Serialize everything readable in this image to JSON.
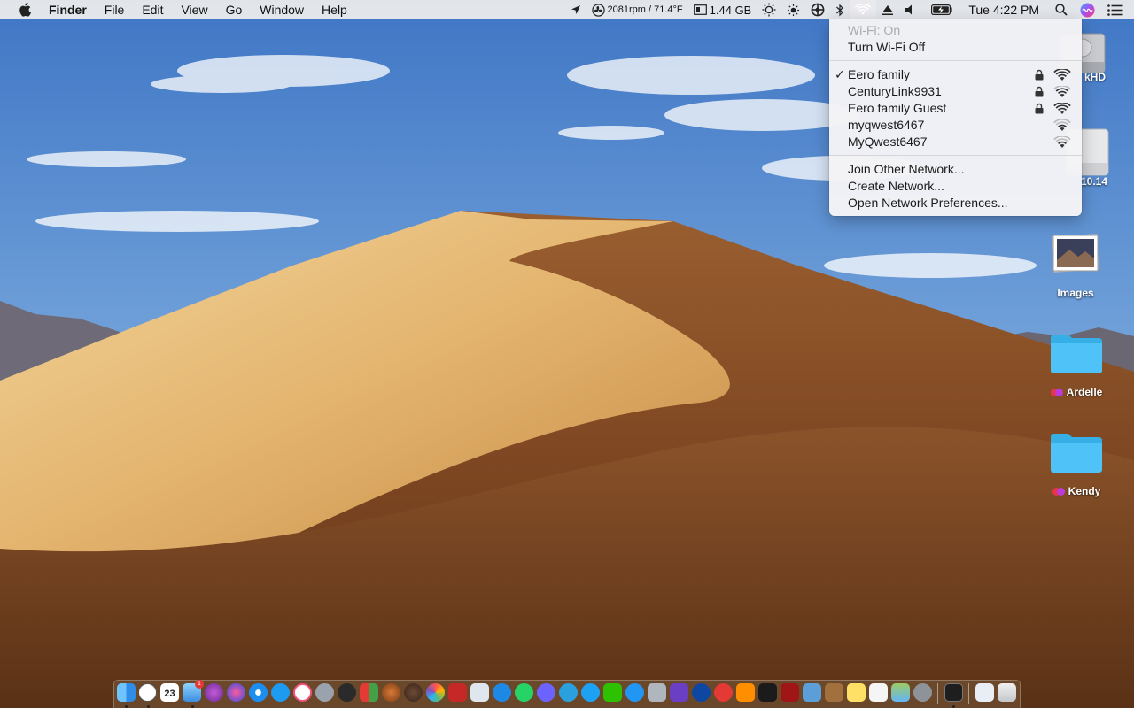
{
  "menubar": {
    "apple_icon": "apple-logo-icon",
    "app_name": "Finder",
    "menus": [
      "File",
      "Edit",
      "View",
      "Go",
      "Window",
      "Help"
    ],
    "status_items": {
      "fan_temp": "2081rpm / 71.4°F",
      "memory": "1.44 GB",
      "clock": "Tue 4:22 PM"
    },
    "icons": [
      "location-arrow-icon",
      "fan-icon",
      "memory-icon",
      "brightness-icon",
      "sun-icon",
      "helm-icon",
      "bluetooth-icon",
      "wifi-icon",
      "airplay-icon",
      "volume-icon",
      "battery-icon",
      "search-icon",
      "siri-icon",
      "notification-list-icon"
    ]
  },
  "wifi_menu": {
    "status": "Wi-Fi: On",
    "toggle": "Turn Wi-Fi Off",
    "networks": [
      {
        "name": "Eero family",
        "connected": true,
        "locked": true
      },
      {
        "name": "CenturyLink9931",
        "connected": false,
        "locked": true
      },
      {
        "name": "Eero family Guest",
        "connected": false,
        "locked": true
      },
      {
        "name": "myqwest6467",
        "connected": false,
        "locked": false
      },
      {
        "name": "MyQwest6467",
        "connected": false,
        "locked": false
      }
    ],
    "actions": {
      "join": "Join Other Network...",
      "create": "Create Network...",
      "prefs": "Open Network Preferences..."
    }
  },
  "desktop": {
    "icons": [
      {
        "label_visible": "kHD",
        "kind": "hard-drive-icon"
      },
      {
        "label_visible": "10.14",
        "kind": "disk-image-icon"
      },
      {
        "label": "Images",
        "kind": "photo-stack-icon"
      },
      {
        "label": "Ardelle",
        "kind": "folder-icon",
        "tags": [
          "#e8344a",
          "#b93bd9"
        ]
      },
      {
        "label": "Kendy",
        "kind": "folder-icon",
        "tags": [
          "#e8344a",
          "#b93bd9"
        ]
      }
    ]
  },
  "dock": {
    "calendar_day": "23",
    "badge": "1",
    "colors": {
      "folder_blue": "#4fc3f7",
      "accent": "#1b73e8"
    }
  }
}
